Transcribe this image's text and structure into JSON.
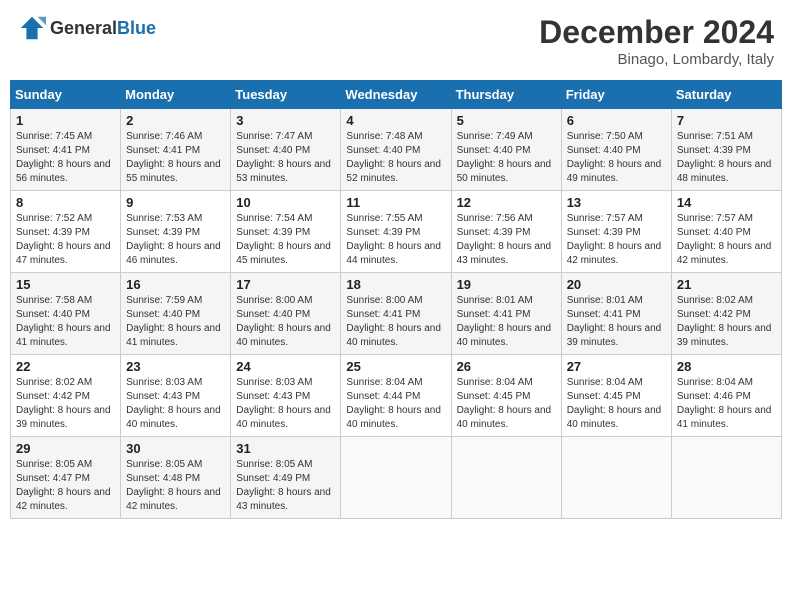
{
  "header": {
    "logo_general": "General",
    "logo_blue": "Blue",
    "month_title": "December 2024",
    "location": "Binago, Lombardy, Italy"
  },
  "weekdays": [
    "Sunday",
    "Monday",
    "Tuesday",
    "Wednesday",
    "Thursday",
    "Friday",
    "Saturday"
  ],
  "weeks": [
    [
      {
        "day": "1",
        "sunrise": "Sunrise: 7:45 AM",
        "sunset": "Sunset: 4:41 PM",
        "daylight": "Daylight: 8 hours and 56 minutes."
      },
      {
        "day": "2",
        "sunrise": "Sunrise: 7:46 AM",
        "sunset": "Sunset: 4:41 PM",
        "daylight": "Daylight: 8 hours and 55 minutes."
      },
      {
        "day": "3",
        "sunrise": "Sunrise: 7:47 AM",
        "sunset": "Sunset: 4:40 PM",
        "daylight": "Daylight: 8 hours and 53 minutes."
      },
      {
        "day": "4",
        "sunrise": "Sunrise: 7:48 AM",
        "sunset": "Sunset: 4:40 PM",
        "daylight": "Daylight: 8 hours and 52 minutes."
      },
      {
        "day": "5",
        "sunrise": "Sunrise: 7:49 AM",
        "sunset": "Sunset: 4:40 PM",
        "daylight": "Daylight: 8 hours and 50 minutes."
      },
      {
        "day": "6",
        "sunrise": "Sunrise: 7:50 AM",
        "sunset": "Sunset: 4:40 PM",
        "daylight": "Daylight: 8 hours and 49 minutes."
      },
      {
        "day": "7",
        "sunrise": "Sunrise: 7:51 AM",
        "sunset": "Sunset: 4:39 PM",
        "daylight": "Daylight: 8 hours and 48 minutes."
      }
    ],
    [
      {
        "day": "8",
        "sunrise": "Sunrise: 7:52 AM",
        "sunset": "Sunset: 4:39 PM",
        "daylight": "Daylight: 8 hours and 47 minutes."
      },
      {
        "day": "9",
        "sunrise": "Sunrise: 7:53 AM",
        "sunset": "Sunset: 4:39 PM",
        "daylight": "Daylight: 8 hours and 46 minutes."
      },
      {
        "day": "10",
        "sunrise": "Sunrise: 7:54 AM",
        "sunset": "Sunset: 4:39 PM",
        "daylight": "Daylight: 8 hours and 45 minutes."
      },
      {
        "day": "11",
        "sunrise": "Sunrise: 7:55 AM",
        "sunset": "Sunset: 4:39 PM",
        "daylight": "Daylight: 8 hours and 44 minutes."
      },
      {
        "day": "12",
        "sunrise": "Sunrise: 7:56 AM",
        "sunset": "Sunset: 4:39 PM",
        "daylight": "Daylight: 8 hours and 43 minutes."
      },
      {
        "day": "13",
        "sunrise": "Sunrise: 7:57 AM",
        "sunset": "Sunset: 4:39 PM",
        "daylight": "Daylight: 8 hours and 42 minutes."
      },
      {
        "day": "14",
        "sunrise": "Sunrise: 7:57 AM",
        "sunset": "Sunset: 4:40 PM",
        "daylight": "Daylight: 8 hours and 42 minutes."
      }
    ],
    [
      {
        "day": "15",
        "sunrise": "Sunrise: 7:58 AM",
        "sunset": "Sunset: 4:40 PM",
        "daylight": "Daylight: 8 hours and 41 minutes."
      },
      {
        "day": "16",
        "sunrise": "Sunrise: 7:59 AM",
        "sunset": "Sunset: 4:40 PM",
        "daylight": "Daylight: 8 hours and 41 minutes."
      },
      {
        "day": "17",
        "sunrise": "Sunrise: 8:00 AM",
        "sunset": "Sunset: 4:40 PM",
        "daylight": "Daylight: 8 hours and 40 minutes."
      },
      {
        "day": "18",
        "sunrise": "Sunrise: 8:00 AM",
        "sunset": "Sunset: 4:41 PM",
        "daylight": "Daylight: 8 hours and 40 minutes."
      },
      {
        "day": "19",
        "sunrise": "Sunrise: 8:01 AM",
        "sunset": "Sunset: 4:41 PM",
        "daylight": "Daylight: 8 hours and 40 minutes."
      },
      {
        "day": "20",
        "sunrise": "Sunrise: 8:01 AM",
        "sunset": "Sunset: 4:41 PM",
        "daylight": "Daylight: 8 hours and 39 minutes."
      },
      {
        "day": "21",
        "sunrise": "Sunrise: 8:02 AM",
        "sunset": "Sunset: 4:42 PM",
        "daylight": "Daylight: 8 hours and 39 minutes."
      }
    ],
    [
      {
        "day": "22",
        "sunrise": "Sunrise: 8:02 AM",
        "sunset": "Sunset: 4:42 PM",
        "daylight": "Daylight: 8 hours and 39 minutes."
      },
      {
        "day": "23",
        "sunrise": "Sunrise: 8:03 AM",
        "sunset": "Sunset: 4:43 PM",
        "daylight": "Daylight: 8 hours and 40 minutes."
      },
      {
        "day": "24",
        "sunrise": "Sunrise: 8:03 AM",
        "sunset": "Sunset: 4:43 PM",
        "daylight": "Daylight: 8 hours and 40 minutes."
      },
      {
        "day": "25",
        "sunrise": "Sunrise: 8:04 AM",
        "sunset": "Sunset: 4:44 PM",
        "daylight": "Daylight: 8 hours and 40 minutes."
      },
      {
        "day": "26",
        "sunrise": "Sunrise: 8:04 AM",
        "sunset": "Sunset: 4:45 PM",
        "daylight": "Daylight: 8 hours and 40 minutes."
      },
      {
        "day": "27",
        "sunrise": "Sunrise: 8:04 AM",
        "sunset": "Sunset: 4:45 PM",
        "daylight": "Daylight: 8 hours and 40 minutes."
      },
      {
        "day": "28",
        "sunrise": "Sunrise: 8:04 AM",
        "sunset": "Sunset: 4:46 PM",
        "daylight": "Daylight: 8 hours and 41 minutes."
      }
    ],
    [
      {
        "day": "29",
        "sunrise": "Sunrise: 8:05 AM",
        "sunset": "Sunset: 4:47 PM",
        "daylight": "Daylight: 8 hours and 42 minutes."
      },
      {
        "day": "30",
        "sunrise": "Sunrise: 8:05 AM",
        "sunset": "Sunset: 4:48 PM",
        "daylight": "Daylight: 8 hours and 42 minutes."
      },
      {
        "day": "31",
        "sunrise": "Sunrise: 8:05 AM",
        "sunset": "Sunset: 4:49 PM",
        "daylight": "Daylight: 8 hours and 43 minutes."
      },
      null,
      null,
      null,
      null
    ]
  ]
}
